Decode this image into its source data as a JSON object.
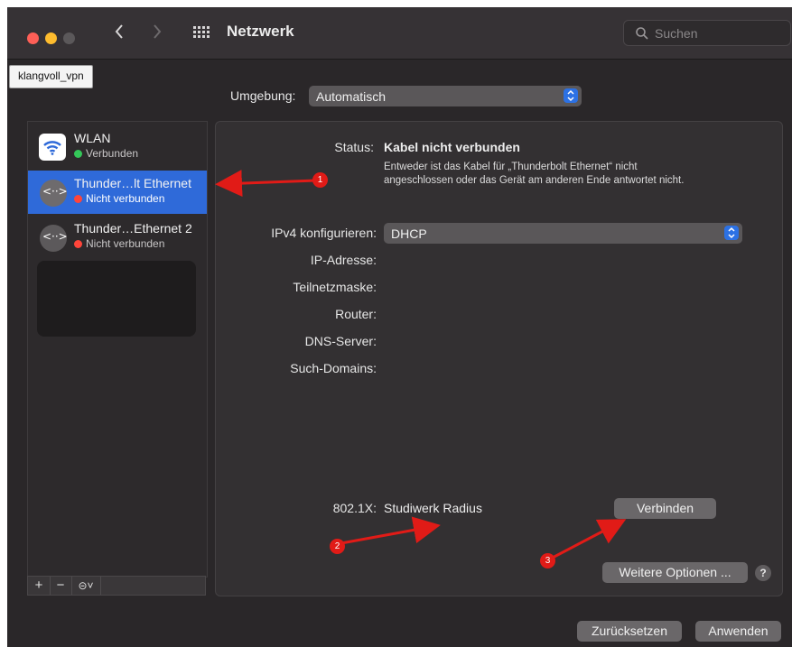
{
  "window": {
    "title": "Netzwerk"
  },
  "titlebar": {
    "search_placeholder": "Suchen"
  },
  "language_button": "klangvoll_vpn",
  "location": {
    "label": "Umgebung:",
    "value": "Automatisch"
  },
  "services": [
    {
      "name": "WLAN",
      "status": "Verbunden",
      "status_color": "#34c759",
      "icon": "wifi-icon"
    },
    {
      "name": "Thunder…lt Ethernet",
      "status": "Nicht verbunden",
      "status_color": "#ff453a",
      "icon": "ethernet-icon"
    },
    {
      "name": "Thunder…Ethernet 2",
      "status": "Nicht verbunden",
      "status_color": "#ff453a",
      "icon": "ethernet-icon"
    }
  ],
  "sidebar_toolbar": {
    "add": "+",
    "remove": "−",
    "action": "⊝˅"
  },
  "detail": {
    "status_label": "Status:",
    "status_value": "Kabel nicht verbunden",
    "status_desc_1": "Entweder ist das Kabel für „Thunderbolt Ethernet“ nicht",
    "status_desc_2": "angeschlossen oder das Gerät am anderen Ende antwortet nicht.",
    "ipv4_label": "IPv4 konfigurieren:",
    "ipv4_value": "DHCP",
    "ip_label": "IP-Adresse:",
    "subnet_label": "Teilnetzmaske:",
    "router_label": "Router:",
    "dns_label": "DNS-Server:",
    "search_domains_label": "Such-Domains:",
    "dot1x_label": "802.1X:",
    "dot1x_value": "Studiwerk Radius",
    "connect_button": "Verbinden",
    "more_options_button": "Weitere Optionen ...",
    "help": "?"
  },
  "footer": {
    "reset_button": "Zurücksetzen",
    "apply_button": "Anwenden"
  },
  "annotations": [
    "1",
    "2",
    "3"
  ],
  "colors": {
    "accent": "#2f6ad9",
    "annotation": "#e11b17"
  }
}
